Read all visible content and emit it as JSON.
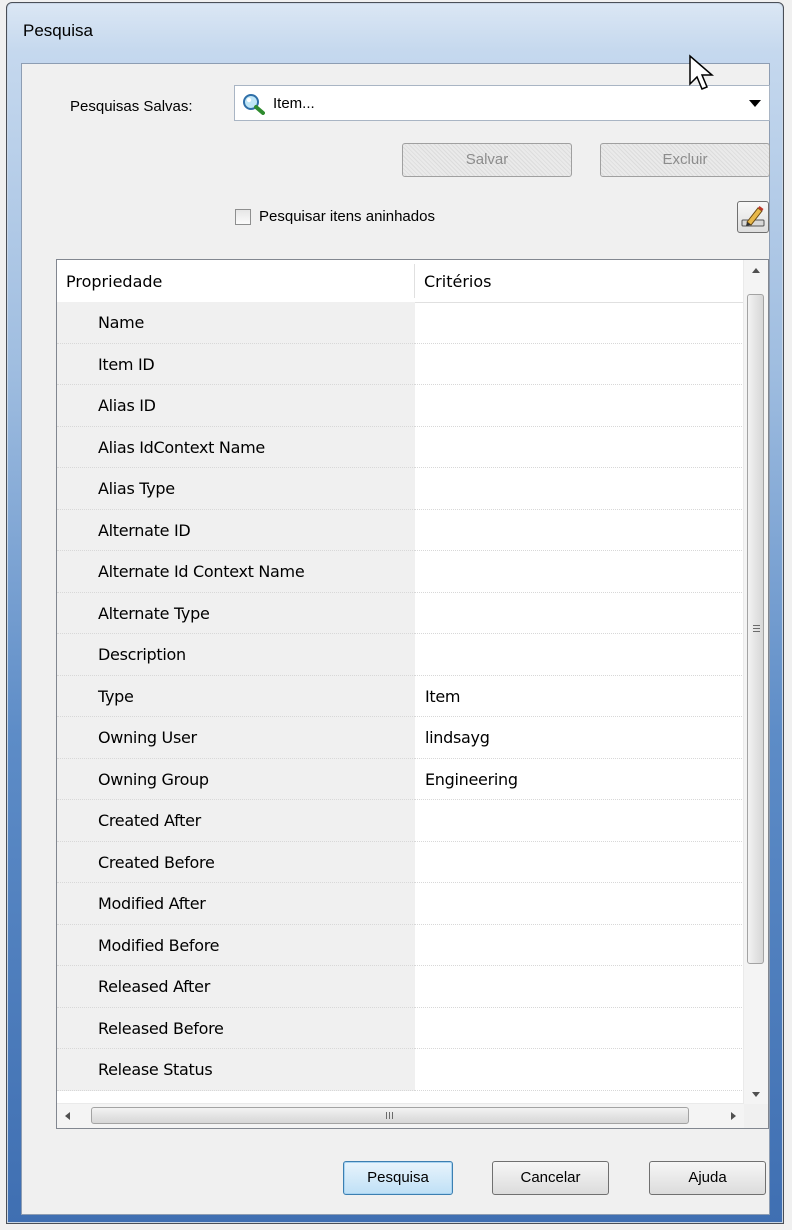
{
  "window": {
    "title": "Pesquisa"
  },
  "saved_searches": {
    "label": "Pesquisas Salvas:",
    "selected": "Item...",
    "icon": "search-magnifier-icon"
  },
  "buttons": {
    "save": "Salvar",
    "delete": "Excluir",
    "search": "Pesquisa",
    "cancel": "Cancelar",
    "help": "Ajuda"
  },
  "nested": {
    "label": "Pesquisar itens aninhados",
    "checked": false
  },
  "table": {
    "headers": {
      "property": "Propriedade",
      "criteria": "Critérios"
    },
    "rows": [
      {
        "property": "Name",
        "criteria": ""
      },
      {
        "property": "Item ID",
        "criteria": ""
      },
      {
        "property": "Alias ID",
        "criteria": ""
      },
      {
        "property": "Alias IdContext Name",
        "criteria": ""
      },
      {
        "property": "Alias Type",
        "criteria": ""
      },
      {
        "property": "Alternate ID",
        "criteria": ""
      },
      {
        "property": "Alternate Id Context Name",
        "criteria": ""
      },
      {
        "property": "Alternate Type",
        "criteria": ""
      },
      {
        "property": "Description",
        "criteria": ""
      },
      {
        "property": "Type",
        "criteria": "Item"
      },
      {
        "property": "Owning User",
        "criteria": "lindsayg"
      },
      {
        "property": "Owning Group",
        "criteria": "Engineering"
      },
      {
        "property": "Created After",
        "criteria": ""
      },
      {
        "property": "Created Before",
        "criteria": ""
      },
      {
        "property": "Modified After",
        "criteria": ""
      },
      {
        "property": "Modified Before",
        "criteria": ""
      },
      {
        "property": "Released After",
        "criteria": ""
      },
      {
        "property": "Released Before",
        "criteria": ""
      },
      {
        "property": "Release Status",
        "criteria": ""
      }
    ]
  }
}
